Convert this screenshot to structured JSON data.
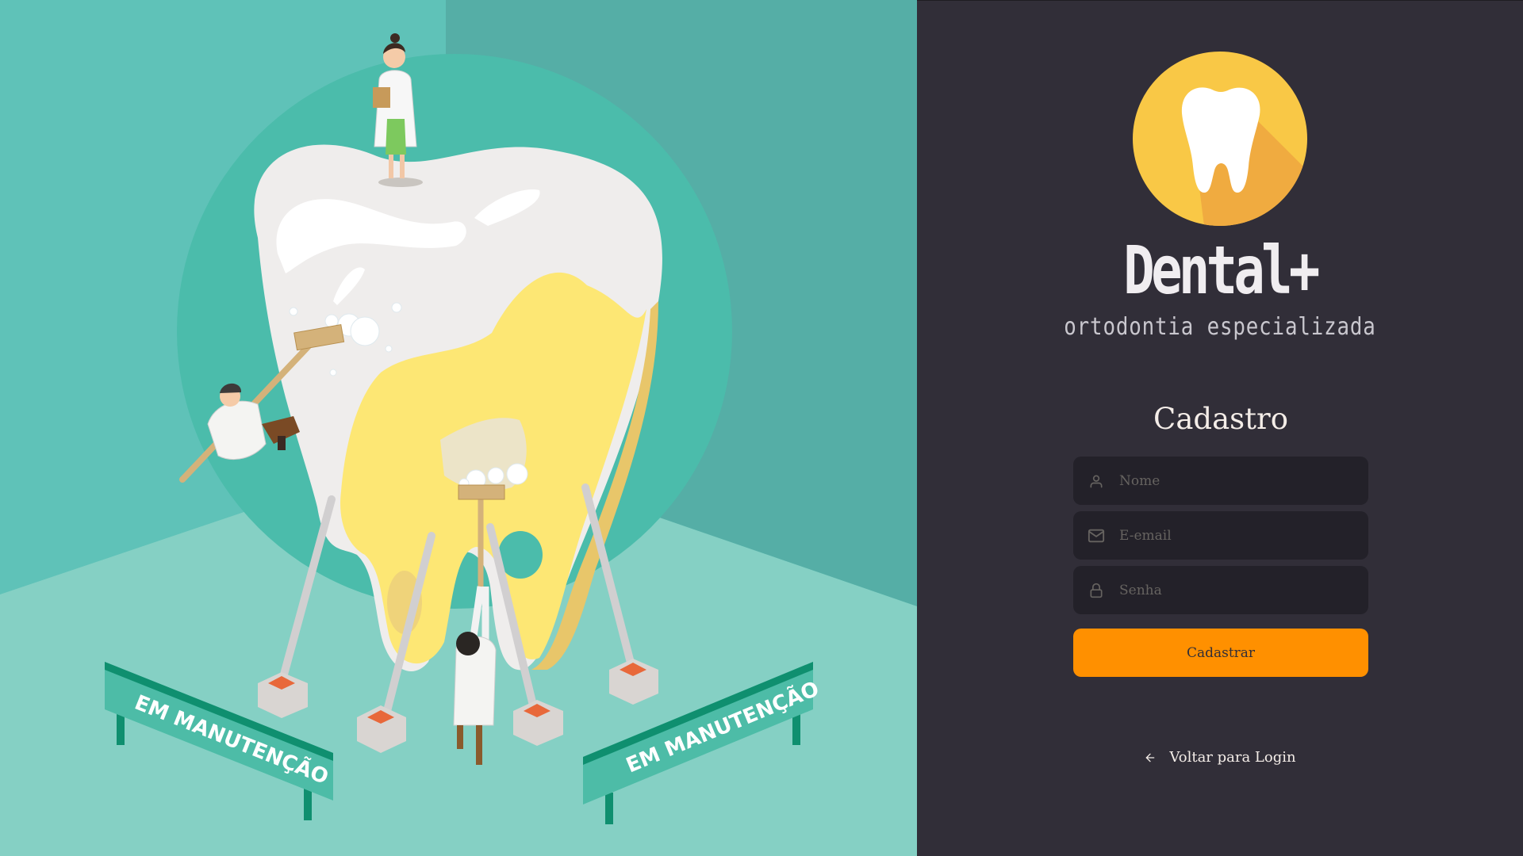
{
  "hero": {
    "illustration": "dentists-maintaining-giant-tooth",
    "sign_left_text": "EM MANUTENÇÃO",
    "sign_right_text": "EM MANUTENÇÃO"
  },
  "brand": {
    "logo_icon": "tooth-icon",
    "name": "Dental+",
    "tagline": "ortodontia especializada"
  },
  "form": {
    "title": "Cadastro",
    "fields": [
      {
        "icon": "user-icon",
        "placeholder": "Nome",
        "value": ""
      },
      {
        "icon": "mail-icon",
        "placeholder": "E-email",
        "value": ""
      },
      {
        "icon": "lock-icon",
        "placeholder": "Senha",
        "value": ""
      }
    ],
    "submit_label": "Cadastrar"
  },
  "back_link": {
    "icon": "arrow-left-icon",
    "label": "Voltar para Login"
  },
  "colors": {
    "panel_background": "#312e38",
    "input_background": "#232129",
    "accent": "#ff9000",
    "hero_teal": "#5fc2b8",
    "logo_yellow": "#f9c846"
  }
}
